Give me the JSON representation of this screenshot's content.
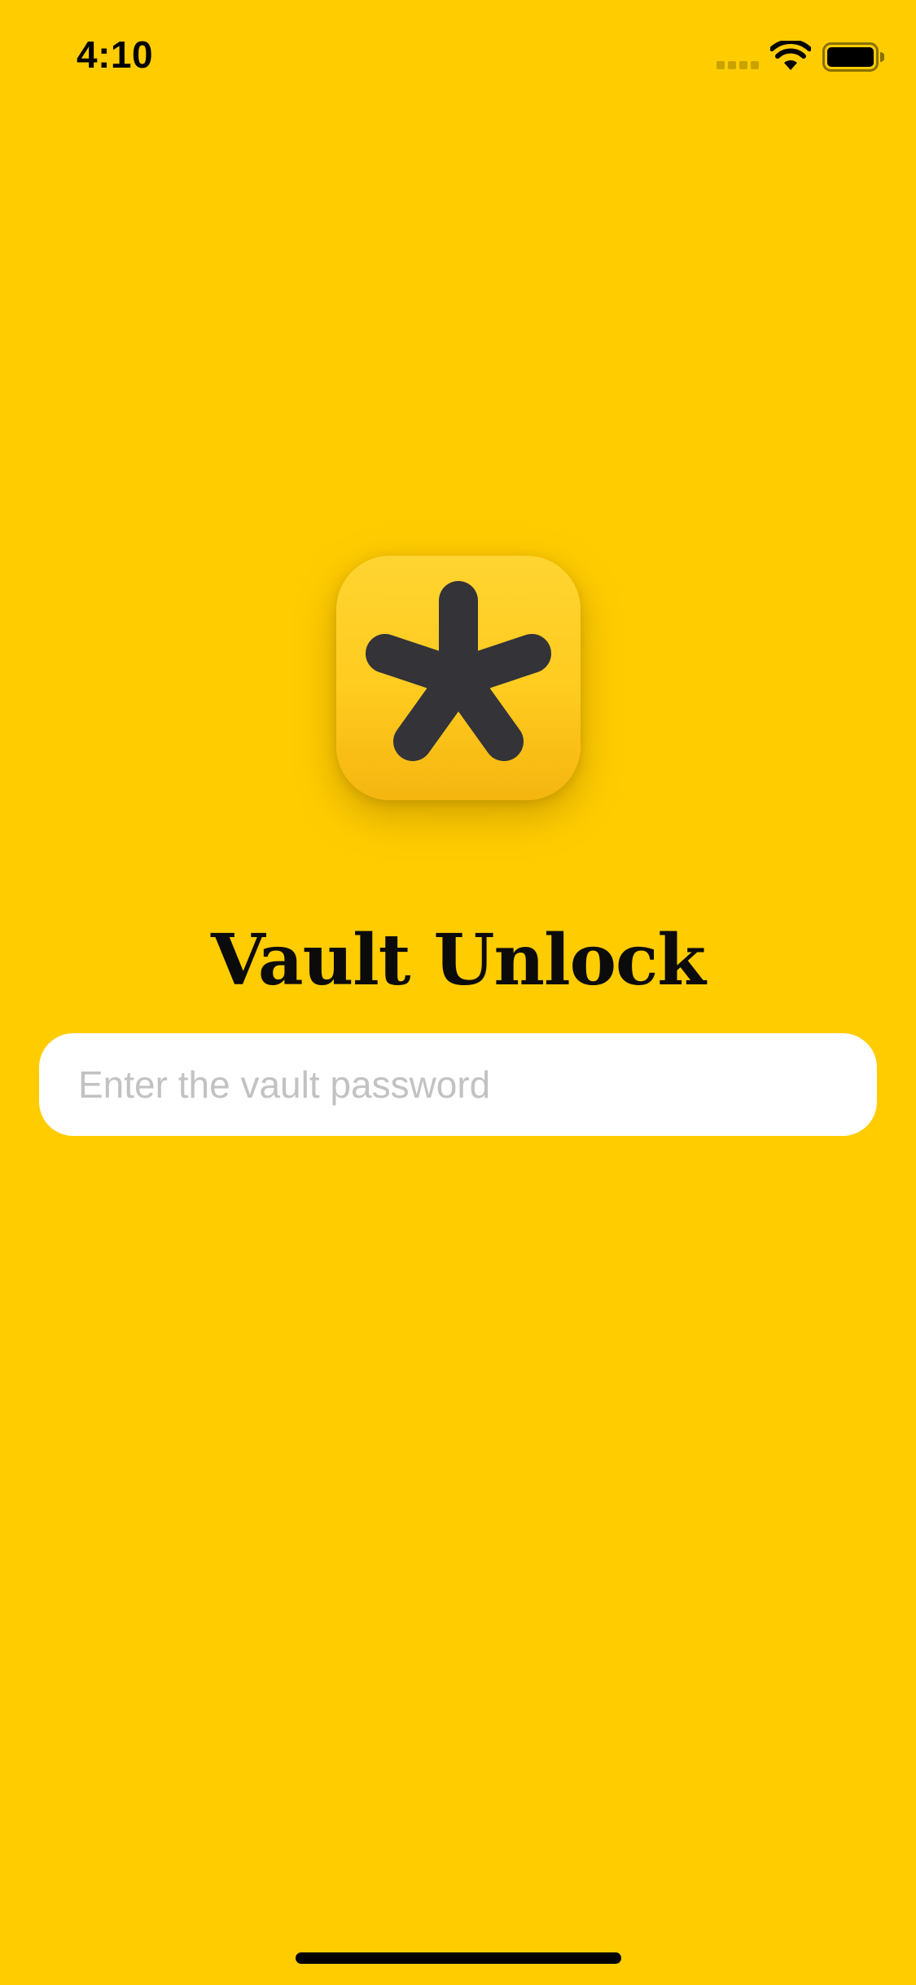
{
  "status_bar": {
    "time": "4:10",
    "icons": [
      "signal-icon",
      "wifi-icon",
      "battery-icon"
    ]
  },
  "app_icon": {
    "name": "asterisk-icon",
    "colors": {
      "background_top": "#FFD431",
      "background_bottom": "#F5B510",
      "glyph": "#333338"
    }
  },
  "title": "Vault Unlock",
  "password": {
    "value": "",
    "placeholder": "Enter the vault password"
  },
  "colors": {
    "background": "#FFCC00",
    "field": "#FFFFFF",
    "placeholder": "#C2C2C2"
  }
}
